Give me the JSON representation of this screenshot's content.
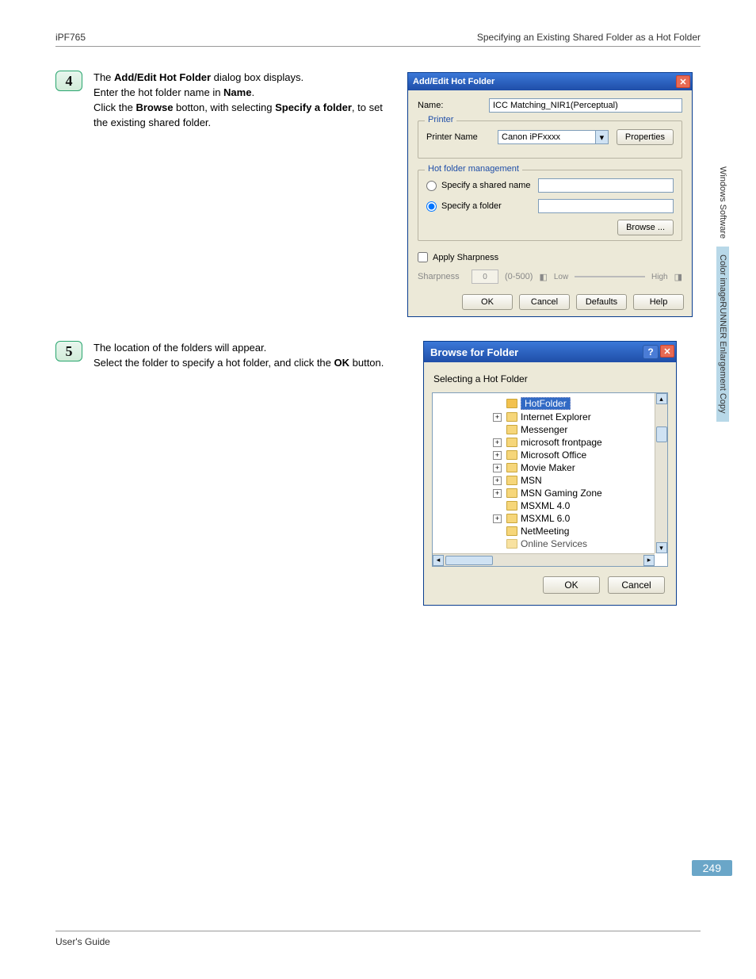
{
  "header": {
    "left": "iPF765",
    "right": "Specifying an Existing Shared Folder as a Hot Folder"
  },
  "footer": {
    "left": "User's Guide"
  },
  "side": {
    "tab1": "Windows Software",
    "tab2": "Color imageRUNNER Enlargement Copy"
  },
  "page_number": "249",
  "step4": {
    "num": "4",
    "line1a": "The ",
    "line1b": "Add/Edit Hot Folder",
    "line1c": " dialog box displays.",
    "line2a": "Enter the hot folder name in ",
    "line2b": "Name",
    "line2c": ".",
    "line3a": "Click the ",
    "line3b": "Browse",
    "line3c": " botton, with selecting ",
    "line3d": "Specify a folder",
    "line3e": ", to set the existing shared folder."
  },
  "step5": {
    "num": "5",
    "line1": "The location of the folders will appear.",
    "line2a": "Select the folder to specify a hot folder, and click the ",
    "line2b": "OK",
    "line2c": " button."
  },
  "dlg1": {
    "title": "Add/Edit Hot Folder",
    "name_label": "Name:",
    "name_value": "ICC Matching_NIR1(Perceptual)",
    "printer_group": "Printer",
    "printer_name_label": "Printer Name",
    "printer_name_value": "Canon iPFxxxx",
    "properties_btn": "Properties",
    "mgmt_group": "Hot folder management",
    "radio_shared": "Specify a shared name",
    "radio_folder": "Specify a folder",
    "browse_btn": "Browse ...",
    "apply_sharpness": "Apply Sharpness",
    "sharpness_label": "Sharpness",
    "sharp_val": "0",
    "sharp_range": "(0-500)",
    "low": "Low",
    "high": "High",
    "ok": "OK",
    "cancel": "Cancel",
    "defaults": "Defaults",
    "help": "Help"
  },
  "dlg2": {
    "title": "Browse for Folder",
    "subtitle": "Selecting a Hot Folder",
    "items": [
      {
        "label": "HotFolder",
        "expandable": false,
        "selected": true,
        "open": true
      },
      {
        "label": "Internet Explorer",
        "expandable": true
      },
      {
        "label": "Messenger",
        "expandable": false
      },
      {
        "label": "microsoft frontpage",
        "expandable": true
      },
      {
        "label": "Microsoft Office",
        "expandable": true
      },
      {
        "label": "Movie Maker",
        "expandable": true
      },
      {
        "label": "MSN",
        "expandable": true
      },
      {
        "label": "MSN Gaming Zone",
        "expandable": true
      },
      {
        "label": "MSXML 4.0",
        "expandable": false
      },
      {
        "label": "MSXML 6.0",
        "expandable": true
      },
      {
        "label": "NetMeeting",
        "expandable": false
      },
      {
        "label": "Online Services",
        "expandable": false,
        "cut": true
      }
    ],
    "ok": "OK",
    "cancel": "Cancel"
  }
}
